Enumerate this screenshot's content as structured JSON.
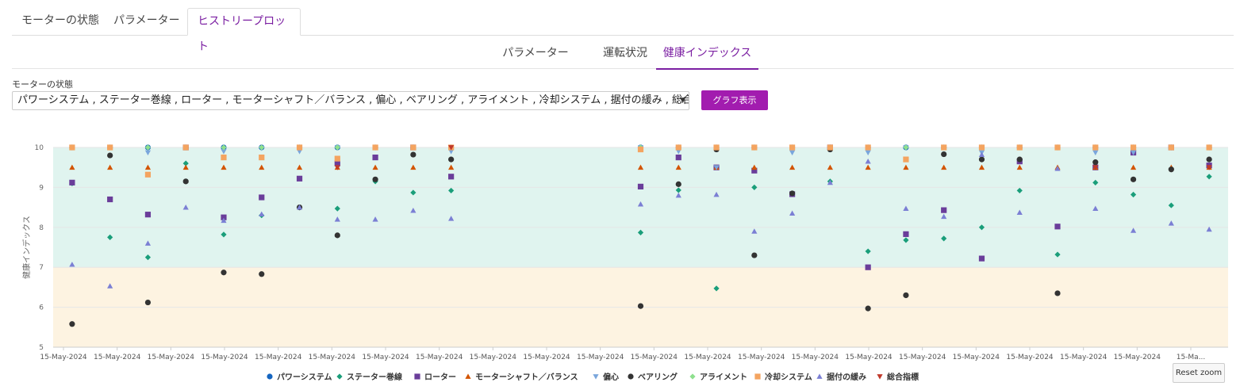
{
  "tabs": [
    {
      "label": "モーターの状態",
      "active": false
    },
    {
      "label": "パラメーター",
      "active": false
    },
    {
      "label": "ヒストリープロット",
      "active": true
    }
  ],
  "subtabs": [
    {
      "label": "パラメーター",
      "active": false
    },
    {
      "label": "運転状況",
      "active": false
    },
    {
      "label": "健康インデックス",
      "active": true
    }
  ],
  "filter": {
    "label": "モーターの状態",
    "selected": "パワーシステム , ステーター巻線 , ローター , モーターシャフト／バランス , 偏心 , ベアリング , アライメント , 冷却システム , 据付の緩み , 総合指標"
  },
  "show_button": "グラフ表示",
  "reset_zoom": "Reset zoom",
  "colors": {
    "accent": "#7b1fa2",
    "button": "#a21caf",
    "healthy_band": "#e0f4ef",
    "warning_band": "#fdf3e1"
  },
  "chart_data": {
    "type": "scatter",
    "title": "",
    "ylabel": "健康インデックス",
    "ylim": [
      5,
      10
    ],
    "yticks": [
      5,
      6,
      7,
      8,
      9,
      10
    ],
    "bands": [
      {
        "from": 7,
        "to": 10,
        "color": "#e0f4ef"
      },
      {
        "from": 5,
        "to": 7,
        "color": "#fdf3e1"
      }
    ],
    "x_tick_labels": [
      "15-May-2024",
      "15-May-2024",
      "15-May-2024",
      "15-May-2024",
      "15-May-2024",
      "15-May-2024",
      "15-May-2024",
      "15-May-2024",
      "15-May-2024",
      "15-May-2024",
      "15-May-2024",
      "15-May-2024",
      "15-May-2024",
      "15-May-2024",
      "15-May-2024",
      "15-May-2024",
      "15-May-2024",
      "15-May-2024",
      "15-May-2024",
      "15-May-2024",
      "15-May-2024",
      "15-Ma..."
    ],
    "x": [
      1,
      2,
      3,
      4,
      5,
      6,
      7,
      8,
      9,
      10,
      11,
      12,
      13,
      14,
      15,
      16,
      17,
      18,
      19,
      20,
      21,
      22,
      23,
      24,
      25,
      26,
      27,
      28,
      29,
      30,
      31
    ],
    "legend_position": "bottom",
    "series": [
      {
        "name": "パワーシステム",
        "color": "#1565c0",
        "marker": "circle",
        "values": [
          10,
          10,
          10,
          10,
          10,
          10,
          10,
          10,
          10,
          10,
          10,
          null,
          null,
          null,
          null,
          10,
          10,
          10,
          10,
          10,
          10,
          10,
          10,
          10,
          10,
          10,
          10,
          10,
          10,
          10,
          10
        ]
      },
      {
        "name": "ステーター巻線",
        "color": "#1a9e7a",
        "marker": "diamond",
        "values": [
          9.1,
          7.75,
          7.25,
          9.6,
          7.82,
          8.3,
          8.5,
          8.47,
          9.15,
          8.87,
          8.92,
          null,
          null,
          null,
          null,
          7.87,
          8.93,
          6.47,
          9.0,
          8.83,
          9.15,
          7.4,
          7.68,
          7.72,
          8.0,
          8.92,
          7.32,
          9.12,
          8.82,
          8.55,
          9.27
        ]
      },
      {
        "name": "ローター",
        "color": "#6a3d9a",
        "marker": "square",
        "values": [
          9.12,
          8.7,
          8.32,
          10,
          8.25,
          8.75,
          9.22,
          9.6,
          9.75,
          10,
          9.27,
          null,
          null,
          null,
          null,
          9.02,
          9.75,
          9.5,
          9.42,
          8.83,
          10,
          7.0,
          7.83,
          8.43,
          7.22,
          9.65,
          8.02,
          9.5,
          9.87,
          10,
          9.55
        ]
      },
      {
        "name": "モーターシャフト／バランス",
        "color": "#d35400",
        "marker": "triangle",
        "values": [
          9.5,
          9.5,
          9.5,
          9.5,
          9.5,
          9.5,
          9.5,
          9.5,
          9.5,
          9.5,
          9.5,
          null,
          null,
          null,
          null,
          9.5,
          9.5,
          9.5,
          9.5,
          9.5,
          9.5,
          9.5,
          9.5,
          9.5,
          9.5,
          9.5,
          9.5,
          9.5,
          9.5,
          9.5,
          9.5
        ]
      },
      {
        "name": "偏心",
        "color": "#7aa6dc",
        "marker": "triangle-down",
        "values": [
          10,
          10,
          9.87,
          10,
          9.9,
          9.98,
          9.9,
          10,
          10,
          10,
          9.9,
          null,
          null,
          null,
          null,
          10,
          9.9,
          9.5,
          10,
          9.87,
          10,
          9.87,
          10,
          10,
          9.87,
          10,
          10,
          9.87,
          9.87,
          10,
          10
        ]
      },
      {
        "name": "ベアリング",
        "color": "#333333",
        "marker": "circle",
        "values": [
          5.58,
          9.8,
          6.12,
          9.15,
          6.87,
          6.83,
          8.5,
          7.8,
          9.2,
          9.82,
          9.7,
          null,
          null,
          null,
          null,
          6.03,
          9.08,
          9.95,
          7.3,
          8.85,
          9.95,
          5.97,
          6.3,
          9.83,
          9.7,
          9.7,
          6.35,
          9.63,
          9.2,
          9.45,
          9.7
        ]
      },
      {
        "name": "アライメント",
        "color": "#8ee08e",
        "marker": "diamond",
        "values": [
          10,
          10,
          10,
          10,
          10,
          10,
          10,
          10,
          10,
          10,
          10,
          null,
          null,
          null,
          null,
          10,
          10,
          10,
          10,
          10,
          10,
          10,
          10,
          10,
          10,
          10,
          10,
          10,
          10,
          10,
          10
        ]
      },
      {
        "name": "冷却システム",
        "color": "#f4a460",
        "marker": "square",
        "values": [
          10,
          10,
          9.32,
          10,
          9.75,
          9.75,
          10,
          9.72,
          10,
          10,
          10,
          null,
          null,
          null,
          null,
          9.95,
          10,
          10,
          10,
          10,
          10,
          10,
          9.7,
          10,
          10,
          10,
          10,
          10,
          10,
          10,
          10
        ]
      },
      {
        "name": "据付の緩み",
        "color": "#7b7fd4",
        "marker": "triangle",
        "values": [
          7.07,
          6.53,
          7.6,
          8.5,
          8.17,
          8.33,
          8.5,
          8.2,
          8.2,
          8.42,
          8.22,
          null,
          null,
          null,
          null,
          8.58,
          8.8,
          8.82,
          7.9,
          8.35,
          9.12,
          9.65,
          8.47,
          8.27,
          9.82,
          8.37,
          9.47,
          8.47,
          7.92,
          8.1,
          7.95
        ]
      },
      {
        "name": "総合指標",
        "color": "#c0392b",
        "marker": "triangle-down",
        "values": [
          null,
          null,
          null,
          null,
          null,
          null,
          null,
          9.5,
          null,
          null,
          10,
          null,
          null,
          null,
          null,
          null,
          null,
          null,
          null,
          null,
          null,
          null,
          null,
          null,
          null,
          null,
          null,
          9.5,
          null,
          null,
          9.5
        ]
      }
    ]
  }
}
